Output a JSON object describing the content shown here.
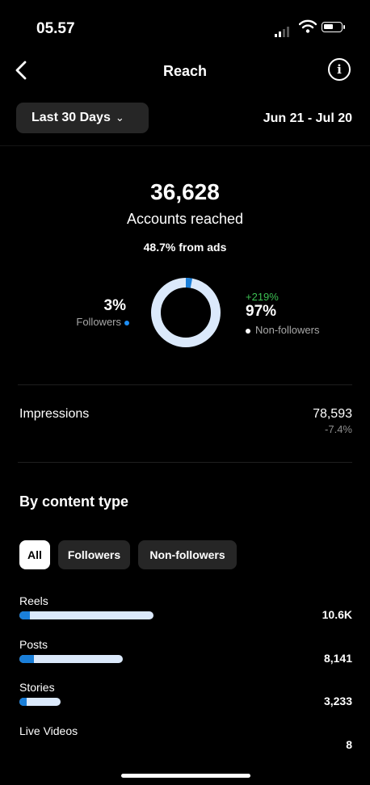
{
  "status_bar": {
    "time": "05.57"
  },
  "header": {
    "title": "Reach"
  },
  "filter": {
    "range_label": "Last 30 Days",
    "date_range": "Jun 21 - Jul 20"
  },
  "summary": {
    "accounts_reached": "36,628",
    "accounts_reached_label": "Accounts reached",
    "ads_note": "48.7% from ads",
    "followers_pct": "3%",
    "followers_label": "Followers",
    "followers_fraction": 0.03,
    "non_followers_growth": "+219%",
    "non_followers_pct": "97%",
    "non_followers_label": "Non-followers"
  },
  "impressions": {
    "label": "Impressions",
    "value": "78,593",
    "change": "-7.4%"
  },
  "content_type": {
    "title": "By content type",
    "chips": [
      "All",
      "Followers",
      "Non-followers"
    ],
    "rows": [
      {
        "label": "Reels",
        "value": "10.6K",
        "bar_fraction": 1.0,
        "followers_fraction": 0.08
      },
      {
        "label": "Posts",
        "value": "8,141",
        "bar_fraction": 0.77,
        "followers_fraction": 0.14
      },
      {
        "label": "Stories",
        "value": "3,233",
        "bar_fraction": 0.31,
        "followers_fraction": 0.17
      },
      {
        "label": "Live Videos",
        "value": "8",
        "bar_fraction": 0,
        "followers_fraction": 0
      }
    ]
  },
  "colors": {
    "accent_blue": "#1a7fd9",
    "bar_light": "#dbe9fb",
    "positive_green": "#3cbf52",
    "muted_text": "#a8a8a8"
  },
  "icons": [
    "back-chevron-icon",
    "info-icon",
    "chevron-down-icon",
    "cellular-signal-icon",
    "wifi-icon",
    "battery-icon"
  ]
}
